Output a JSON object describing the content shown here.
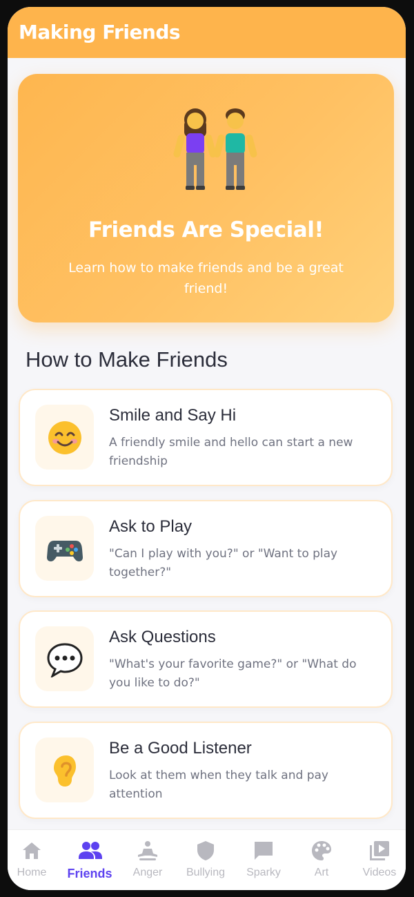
{
  "header": {
    "title": "Making Friends"
  },
  "hero": {
    "illustration": "two-friends-icon",
    "title": "Friends Are Special!",
    "subtitle": "Learn how to make friends and be a great friend!"
  },
  "section": {
    "title": "How to Make Friends"
  },
  "cards": [
    {
      "icon": "smiling-face-icon",
      "title": "Smile and Say Hi",
      "description": "A friendly smile and hello can start a new friendship"
    },
    {
      "icon": "game-controller-icon",
      "title": "Ask to Play",
      "description": "\"Can I play with you?\" or \"Want to play together?\""
    },
    {
      "icon": "speech-bubble-icon",
      "title": "Ask Questions",
      "description": "\"What's your favorite game?\" or \"What do you like to do?\""
    },
    {
      "icon": "ear-icon",
      "title": "Be a Good Listener",
      "description": "Look at them when they talk and pay attention"
    }
  ],
  "nav": {
    "items": [
      {
        "label": "Home",
        "icon": "home-icon",
        "active": false
      },
      {
        "label": "Friends",
        "icon": "people-icon",
        "active": true
      },
      {
        "label": "Anger",
        "icon": "meditation-icon",
        "active": false
      },
      {
        "label": "Bullying",
        "icon": "shield-icon",
        "active": false
      },
      {
        "label": "Sparky",
        "icon": "chat-icon",
        "active": false
      },
      {
        "label": "Art",
        "icon": "palette-icon",
        "active": false
      },
      {
        "label": "Videos",
        "icon": "video-library-icon",
        "active": false
      }
    ]
  },
  "colors": {
    "header": "#feb44c",
    "accent_active": "#5d42f0",
    "card_border": "#ffe8c8",
    "icon_box_bg": "#fff7ea"
  }
}
